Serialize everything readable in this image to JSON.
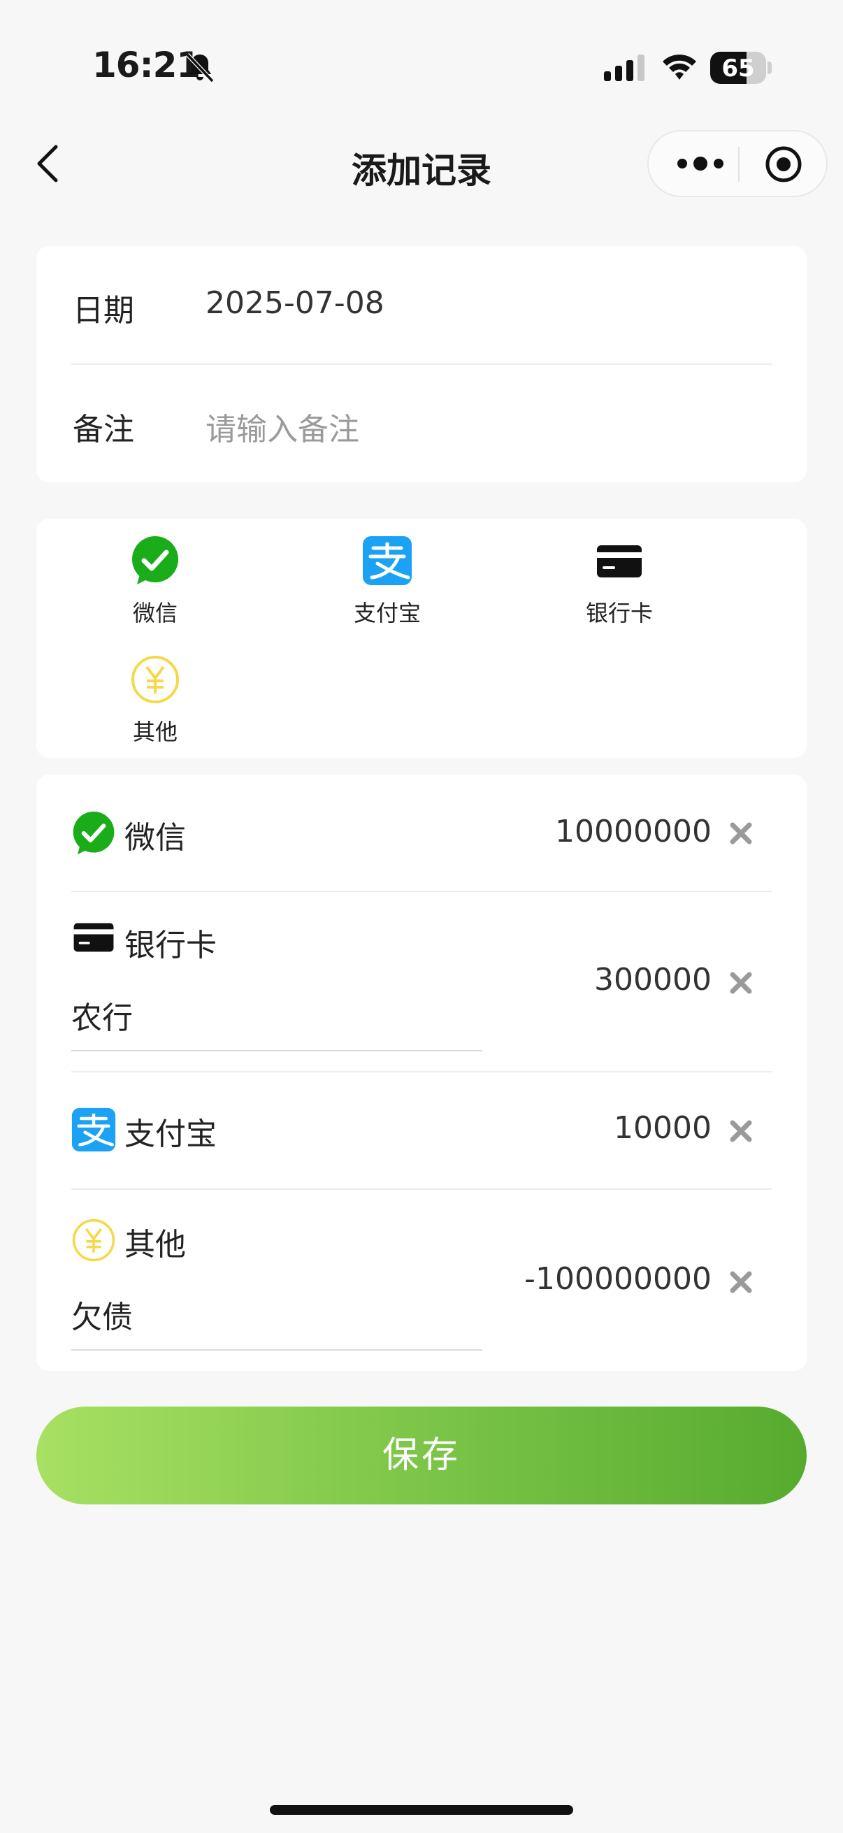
{
  "status_bar": {
    "time": "16:21",
    "battery": "65",
    "battery_level": 0.65,
    "icons": [
      "bell-slash-icon",
      "signal-icon",
      "wifi-icon",
      "battery-icon"
    ]
  },
  "nav": {
    "title": "添加记录",
    "icons": [
      "chevron-left-icon",
      "more-dots-icon",
      "target-icon"
    ]
  },
  "form": {
    "date_label": "日期",
    "date_value": "2025-07-08",
    "note_label": "备注",
    "note_placeholder": "请输入备注",
    "note_value": ""
  },
  "payment_methods": [
    {
      "label": "微信",
      "icon": "wechat-icon"
    },
    {
      "label": "支付宝",
      "icon": "alipay-icon"
    },
    {
      "label": "银行卡",
      "icon": "bank-card-icon"
    },
    {
      "label": "其他",
      "icon": "yuan-coin-icon"
    }
  ],
  "entries": [
    {
      "name": "微信",
      "icon": "wechat-icon",
      "amount": "10000000",
      "note": ""
    },
    {
      "name": "银行卡",
      "icon": "bank-card-icon",
      "amount": "300000",
      "note": "农行"
    },
    {
      "name": "支付宝",
      "icon": "alipay-icon",
      "amount": "10000",
      "note": ""
    },
    {
      "name": "其他",
      "icon": "yuan-coin-icon",
      "amount": "-100000000",
      "note": "欠债"
    }
  ],
  "save_label": "保存",
  "colors": {
    "wechat": "#1aad19",
    "alipay": "#1677ff",
    "other_coin": "#f7d84a",
    "save_gradient_start": "#a8e063",
    "save_gradient_end": "#56ab2f",
    "background": "#f7f7f7"
  }
}
